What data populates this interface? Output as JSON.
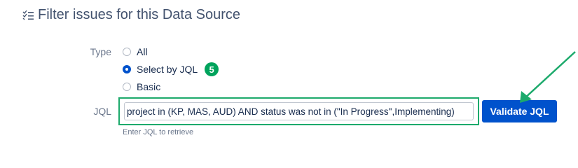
{
  "header": {
    "title": "Filter issues for this Data Source",
    "icon": "filter-list-icon"
  },
  "type_field": {
    "label": "Type",
    "options": [
      {
        "label": "All",
        "checked": false
      },
      {
        "label": "Select by JQL",
        "checked": true
      },
      {
        "label": "Basic",
        "checked": false
      }
    ],
    "step_badge": "5"
  },
  "jql_field": {
    "label": "JQL",
    "value": "project in (KP, MAS, AUD) AND status was not in (\"In Progress\",Implementing)",
    "helper": "Enter JQL to retrieve"
  },
  "validate_button": {
    "label": "Validate JQL"
  },
  "colors": {
    "accent": "#0052cc",
    "highlight": "#1daa6c",
    "badge": "#00a35c"
  }
}
